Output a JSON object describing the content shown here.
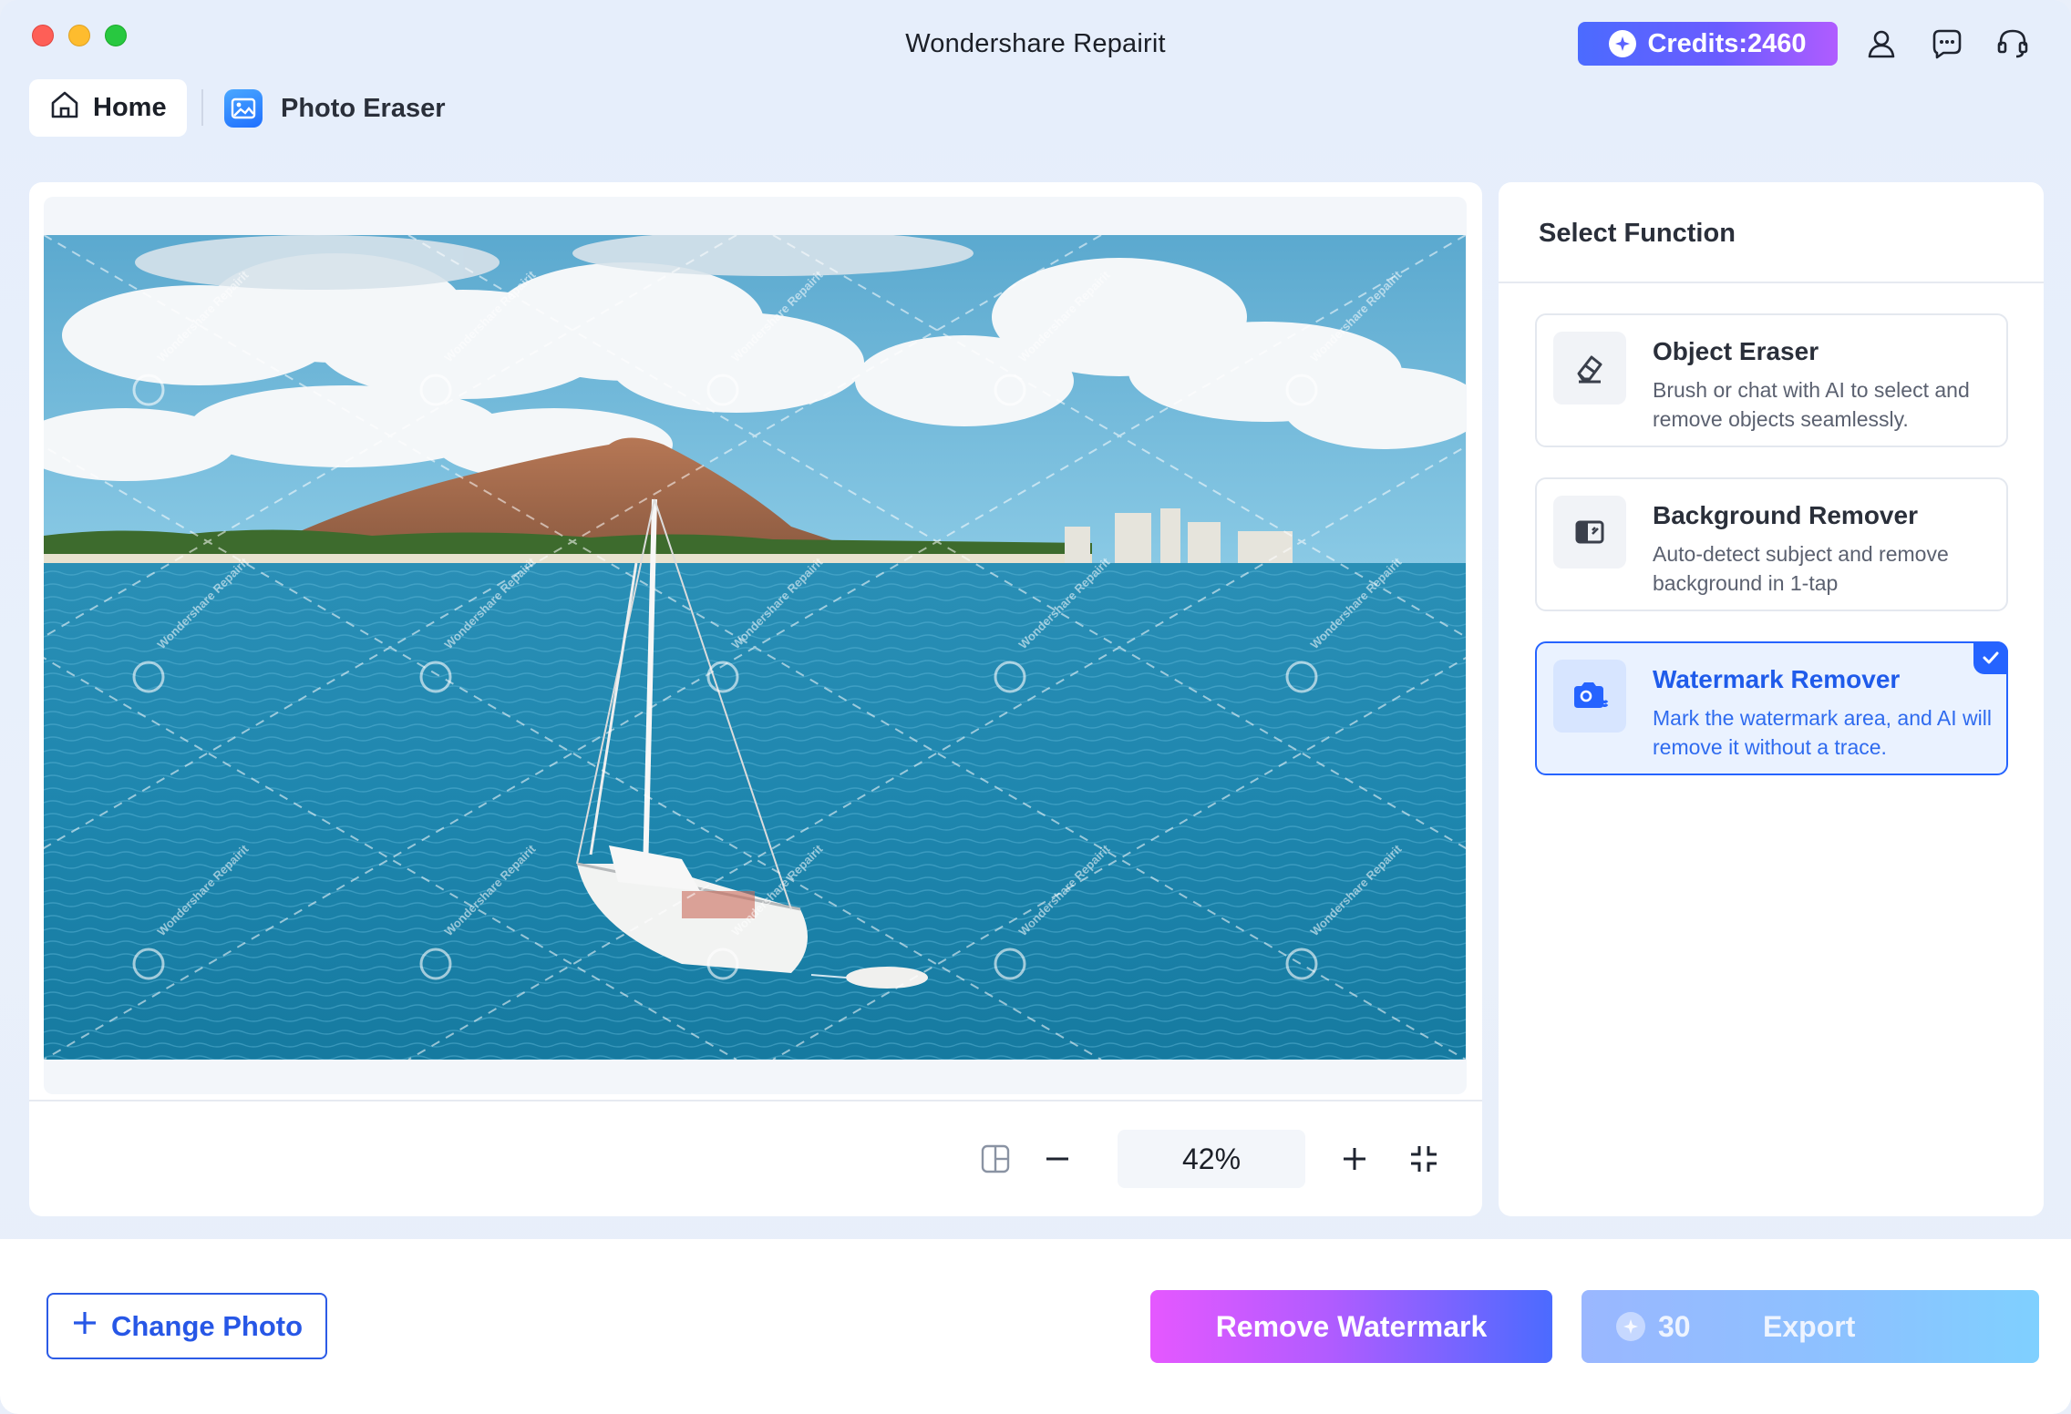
{
  "window": {
    "title": "Wondershare Repairit"
  },
  "header": {
    "credits_label": "Credits:2460",
    "icons": [
      "user-icon",
      "chat-icon",
      "headset-icon"
    ]
  },
  "tabs": {
    "home_label": "Home",
    "current_label": "Photo Eraser"
  },
  "canvas": {
    "zoom": "42%",
    "watermark_text": "Wondershare Repairit"
  },
  "functions": {
    "title": "Select Function",
    "items": [
      {
        "name": "Object Eraser",
        "desc": "Brush or chat with AI to select and remove objects seamlessly.",
        "selected": false,
        "icon": "eraser-icon"
      },
      {
        "name": "Background Remover",
        "desc": "Auto-detect subject and remove background in 1-tap",
        "selected": false,
        "icon": "background-remover-icon"
      },
      {
        "name": "Watermark Remover",
        "desc": "Mark the watermark area, and AI will remove it without a trace.",
        "selected": true,
        "icon": "watermark-remover-icon"
      }
    ]
  },
  "footer": {
    "change_photo_label": "Change Photo",
    "remove_label": "Remove Watermark",
    "export_cost": "30",
    "export_label": "Export"
  },
  "colors": {
    "accent": "#2563ff",
    "gradient_start": "#e558ff",
    "gradient_end": "#4b6bff"
  }
}
